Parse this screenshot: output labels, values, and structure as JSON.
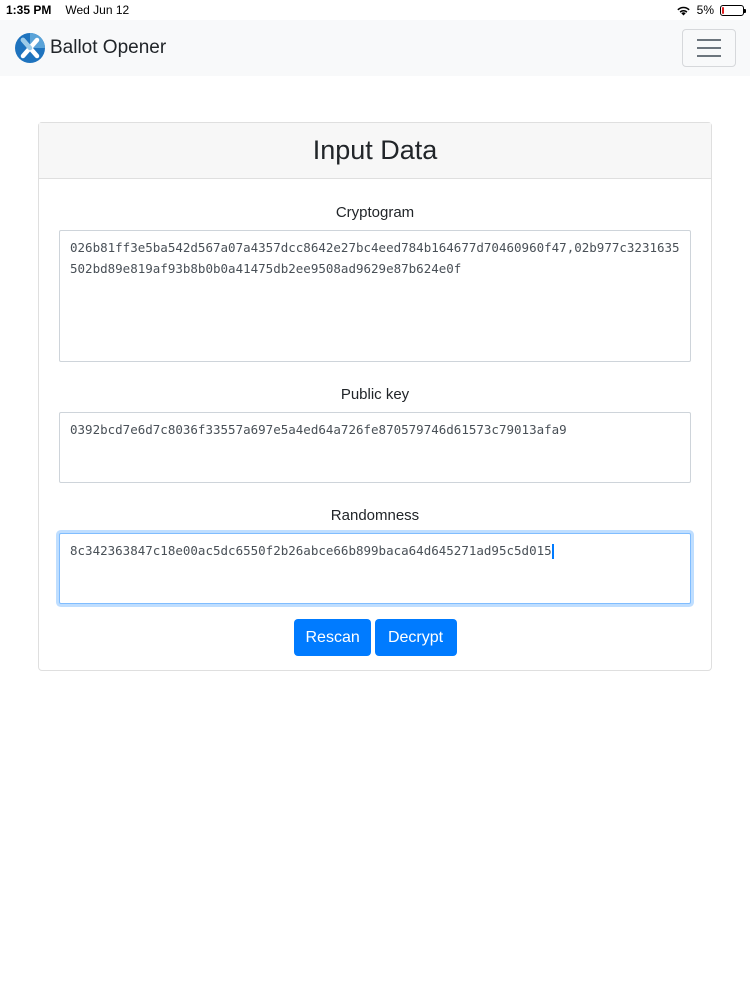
{
  "status_bar": {
    "time": "1:35 PM",
    "date": "Wed Jun 12",
    "battery": "5%",
    "battery_level": 0.05,
    "icons": [
      "wifi-icon",
      "battery-icon"
    ]
  },
  "navbar": {
    "brand": "Ballot Opener",
    "logo_icon": "ballot-x-logo-icon",
    "menu_icon": "hamburger-menu-icon"
  },
  "card": {
    "title": "Input Data",
    "fields": {
      "cryptogram": {
        "label": "Cryptogram",
        "value": "026b81ff3e5ba542d567a07a4357dcc8642e27bc4eed784b164677d70460960f47,02b977c3231635502bd89e819af93b8b0b0a41475db2ee9508ad9629e87b624e0f"
      },
      "public_key": {
        "label": "Public key",
        "value": "0392bcd7e6d7c8036f33557a697e5a4ed64a726fe870579746d61573c79013afa9"
      },
      "randomness": {
        "label": "Randomness",
        "value": "8c342363847c18e00ac5dc6550f2b26abce66b899baca64d645271ad95c5d015"
      }
    },
    "buttons": {
      "rescan": "Rescan",
      "decrypt": "Decrypt"
    }
  },
  "colors": {
    "primary": "#007bff",
    "navbar_bg": "#f8f9fa",
    "card_header_bg": "#f7f7f7",
    "logo_blue": "#1e73be",
    "logo_light": "#9ccbe8"
  }
}
